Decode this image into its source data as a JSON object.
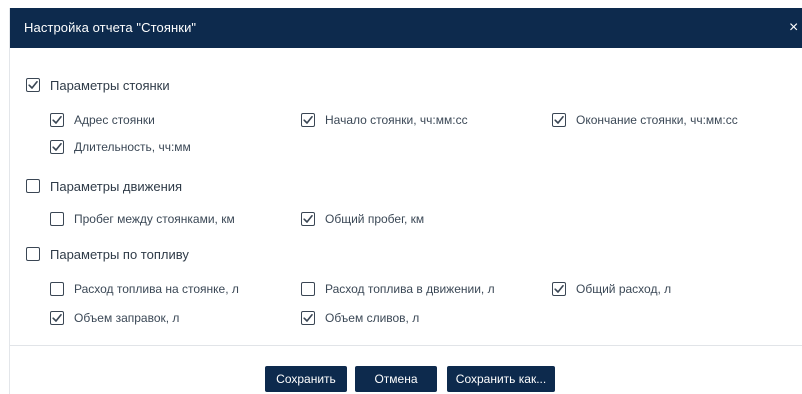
{
  "dialog": {
    "title": "Настройка отчета \"Стоянки\"",
    "close_glyph": "×"
  },
  "groups": [
    {
      "label": "Параметры стоянки",
      "checked": true,
      "items": [
        {
          "label": "Адрес стоянки",
          "checked": true
        },
        {
          "label": "Начало стоянки, чч:мм:сс",
          "checked": true
        },
        {
          "label": "Окончание стоянки, чч:мм:сс",
          "checked": true
        },
        {
          "label": "Длительность, чч:мм",
          "checked": true
        }
      ]
    },
    {
      "label": "Параметры движения",
      "checked": false,
      "items": [
        {
          "label": "Пробег между стоянками, км",
          "checked": false
        },
        {
          "label": "Общий пробег, км",
          "checked": true
        }
      ]
    },
    {
      "label": "Параметры по топливу",
      "checked": false,
      "items": [
        {
          "label": "Расход топлива на стоянке, л",
          "checked": false
        },
        {
          "label": "Расход топлива в движении, л",
          "checked": false
        },
        {
          "label": "Общий расход, л",
          "checked": true
        },
        {
          "label": "Объем заправок, л",
          "checked": true
        },
        {
          "label": "Объем сливов, л",
          "checked": true
        }
      ]
    }
  ],
  "footer": {
    "save_label": "Сохранить",
    "cancel_label": "Отмена",
    "save_as_label": "Сохранить как..."
  },
  "colors": {
    "header_bg": "#0d2a4d",
    "button_bg": "#0d2a4d",
    "checkbox_border": "#3a4654",
    "text": "#3b4856"
  }
}
